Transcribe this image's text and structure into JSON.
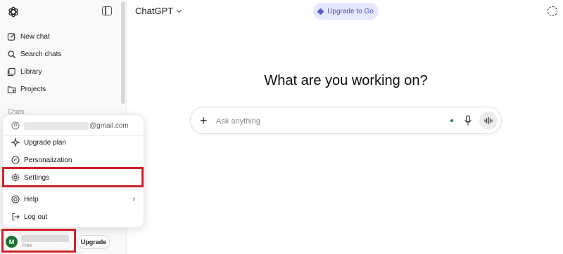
{
  "sidebar": {
    "nav": [
      {
        "label": "New chat",
        "icon": "edit-icon"
      },
      {
        "label": "Search chats",
        "icon": "search-icon"
      },
      {
        "label": "Library",
        "icon": "library-icon"
      },
      {
        "label": "Projects",
        "icon": "folder-icon"
      }
    ],
    "section_label": "Chats"
  },
  "account_menu": {
    "email_suffix": "@gmail.com",
    "items": [
      {
        "label": "Upgrade plan",
        "icon": "sparkle-icon"
      },
      {
        "label": "Personalization",
        "icon": "personalization-icon"
      },
      {
        "label": "Settings",
        "icon": "gear-icon"
      },
      {
        "label": "Help",
        "icon": "lifebuoy-icon"
      },
      {
        "label": "Log out",
        "icon": "logout-icon"
      }
    ],
    "chevron": "›"
  },
  "account": {
    "avatar_initial": "M",
    "plan": "Free",
    "upgrade_label": "Upgrade"
  },
  "header": {
    "title": "ChatGPT",
    "upgrade_label": "Upgrade to Go"
  },
  "main": {
    "heading": "What are you working on?",
    "composer_placeholder": "Ask anything"
  },
  "colors": {
    "highlight": "#d0202a",
    "upgrade_pill_bg": "#e6e8ff",
    "upgrade_pill_text": "#4a4fb8",
    "avatar_bg": "#1f6f33"
  }
}
